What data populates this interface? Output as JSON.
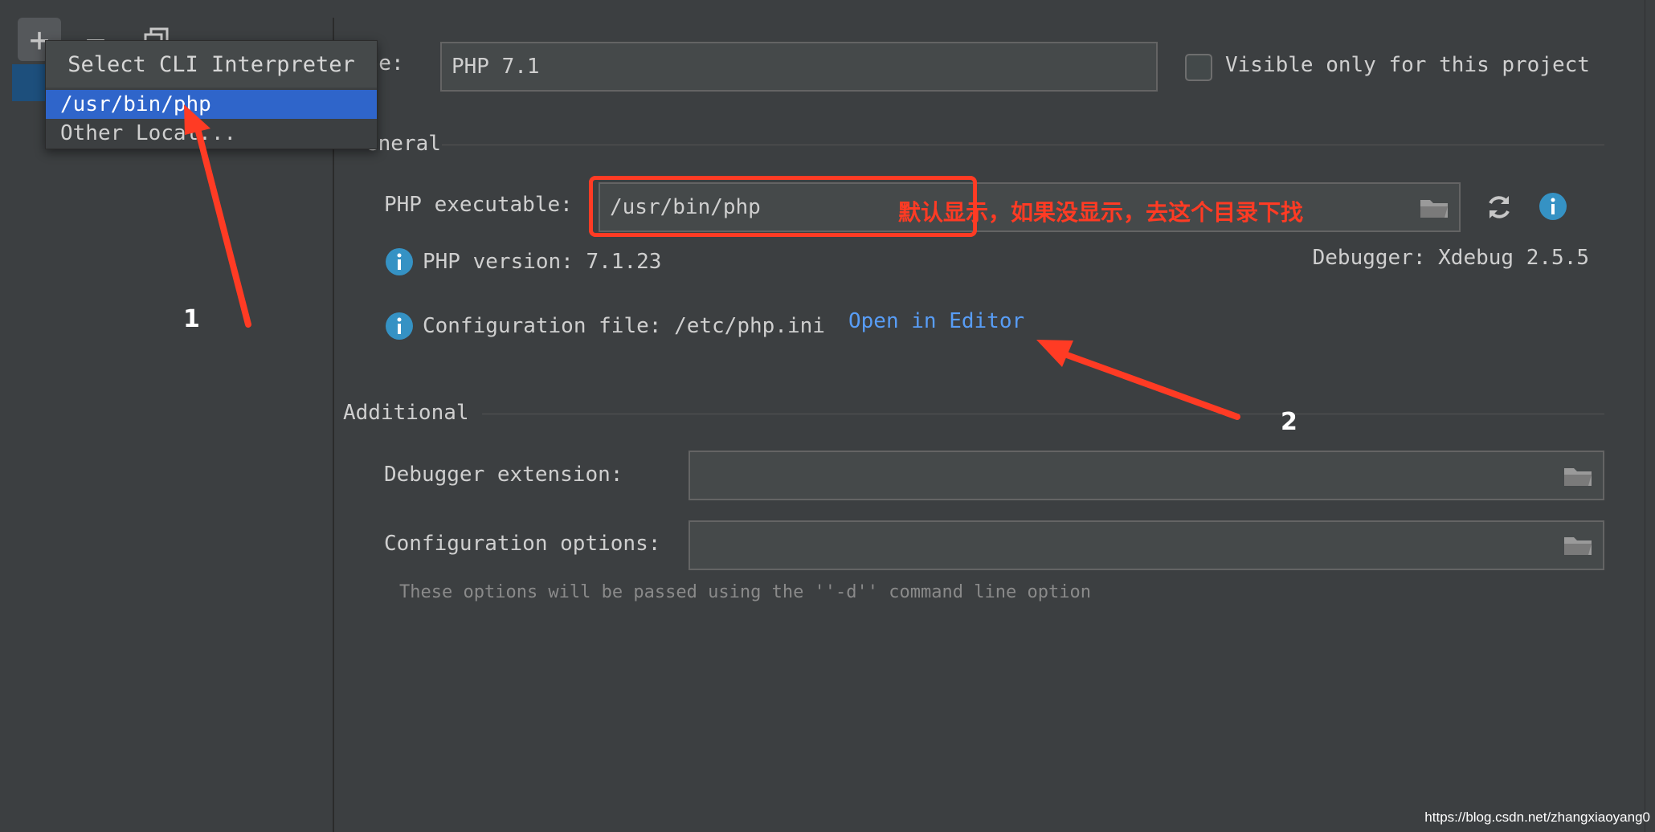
{
  "toolbar": {
    "add": "+",
    "remove": "−"
  },
  "popup": {
    "title": "Select CLI Interpreter",
    "items": [
      "/usr/bin/php",
      "Other Local..."
    ]
  },
  "name_row": {
    "label": "ame:",
    "value": "PHP 7.1",
    "checkbox_label": "Visible only for this project"
  },
  "general": {
    "section": "eneral",
    "php_exec_label": "PHP executable:",
    "php_exec_value": "/usr/bin/php",
    "php_version": "PHP version: 7.1.23",
    "debugger": "Debugger: Xdebug 2.5.5",
    "config_file": "Configuration file: /etc/php.ini",
    "open_editor": "Open in Editor"
  },
  "additional": {
    "section": "Additional",
    "debugger_ext_label": "Debugger extension:",
    "debugger_ext_value": "",
    "config_options_label": "Configuration options:",
    "config_options_value": "",
    "hint": "These options will be passed using the ''-d'' command line option"
  },
  "annotations": {
    "text": "默认显示，如果没显示，去这个目录下找",
    "num1": "1",
    "num2": "2",
    "color": "#ff3b24"
  },
  "watermark": "https://blog.csdn.net/zhangxiaoyang0"
}
